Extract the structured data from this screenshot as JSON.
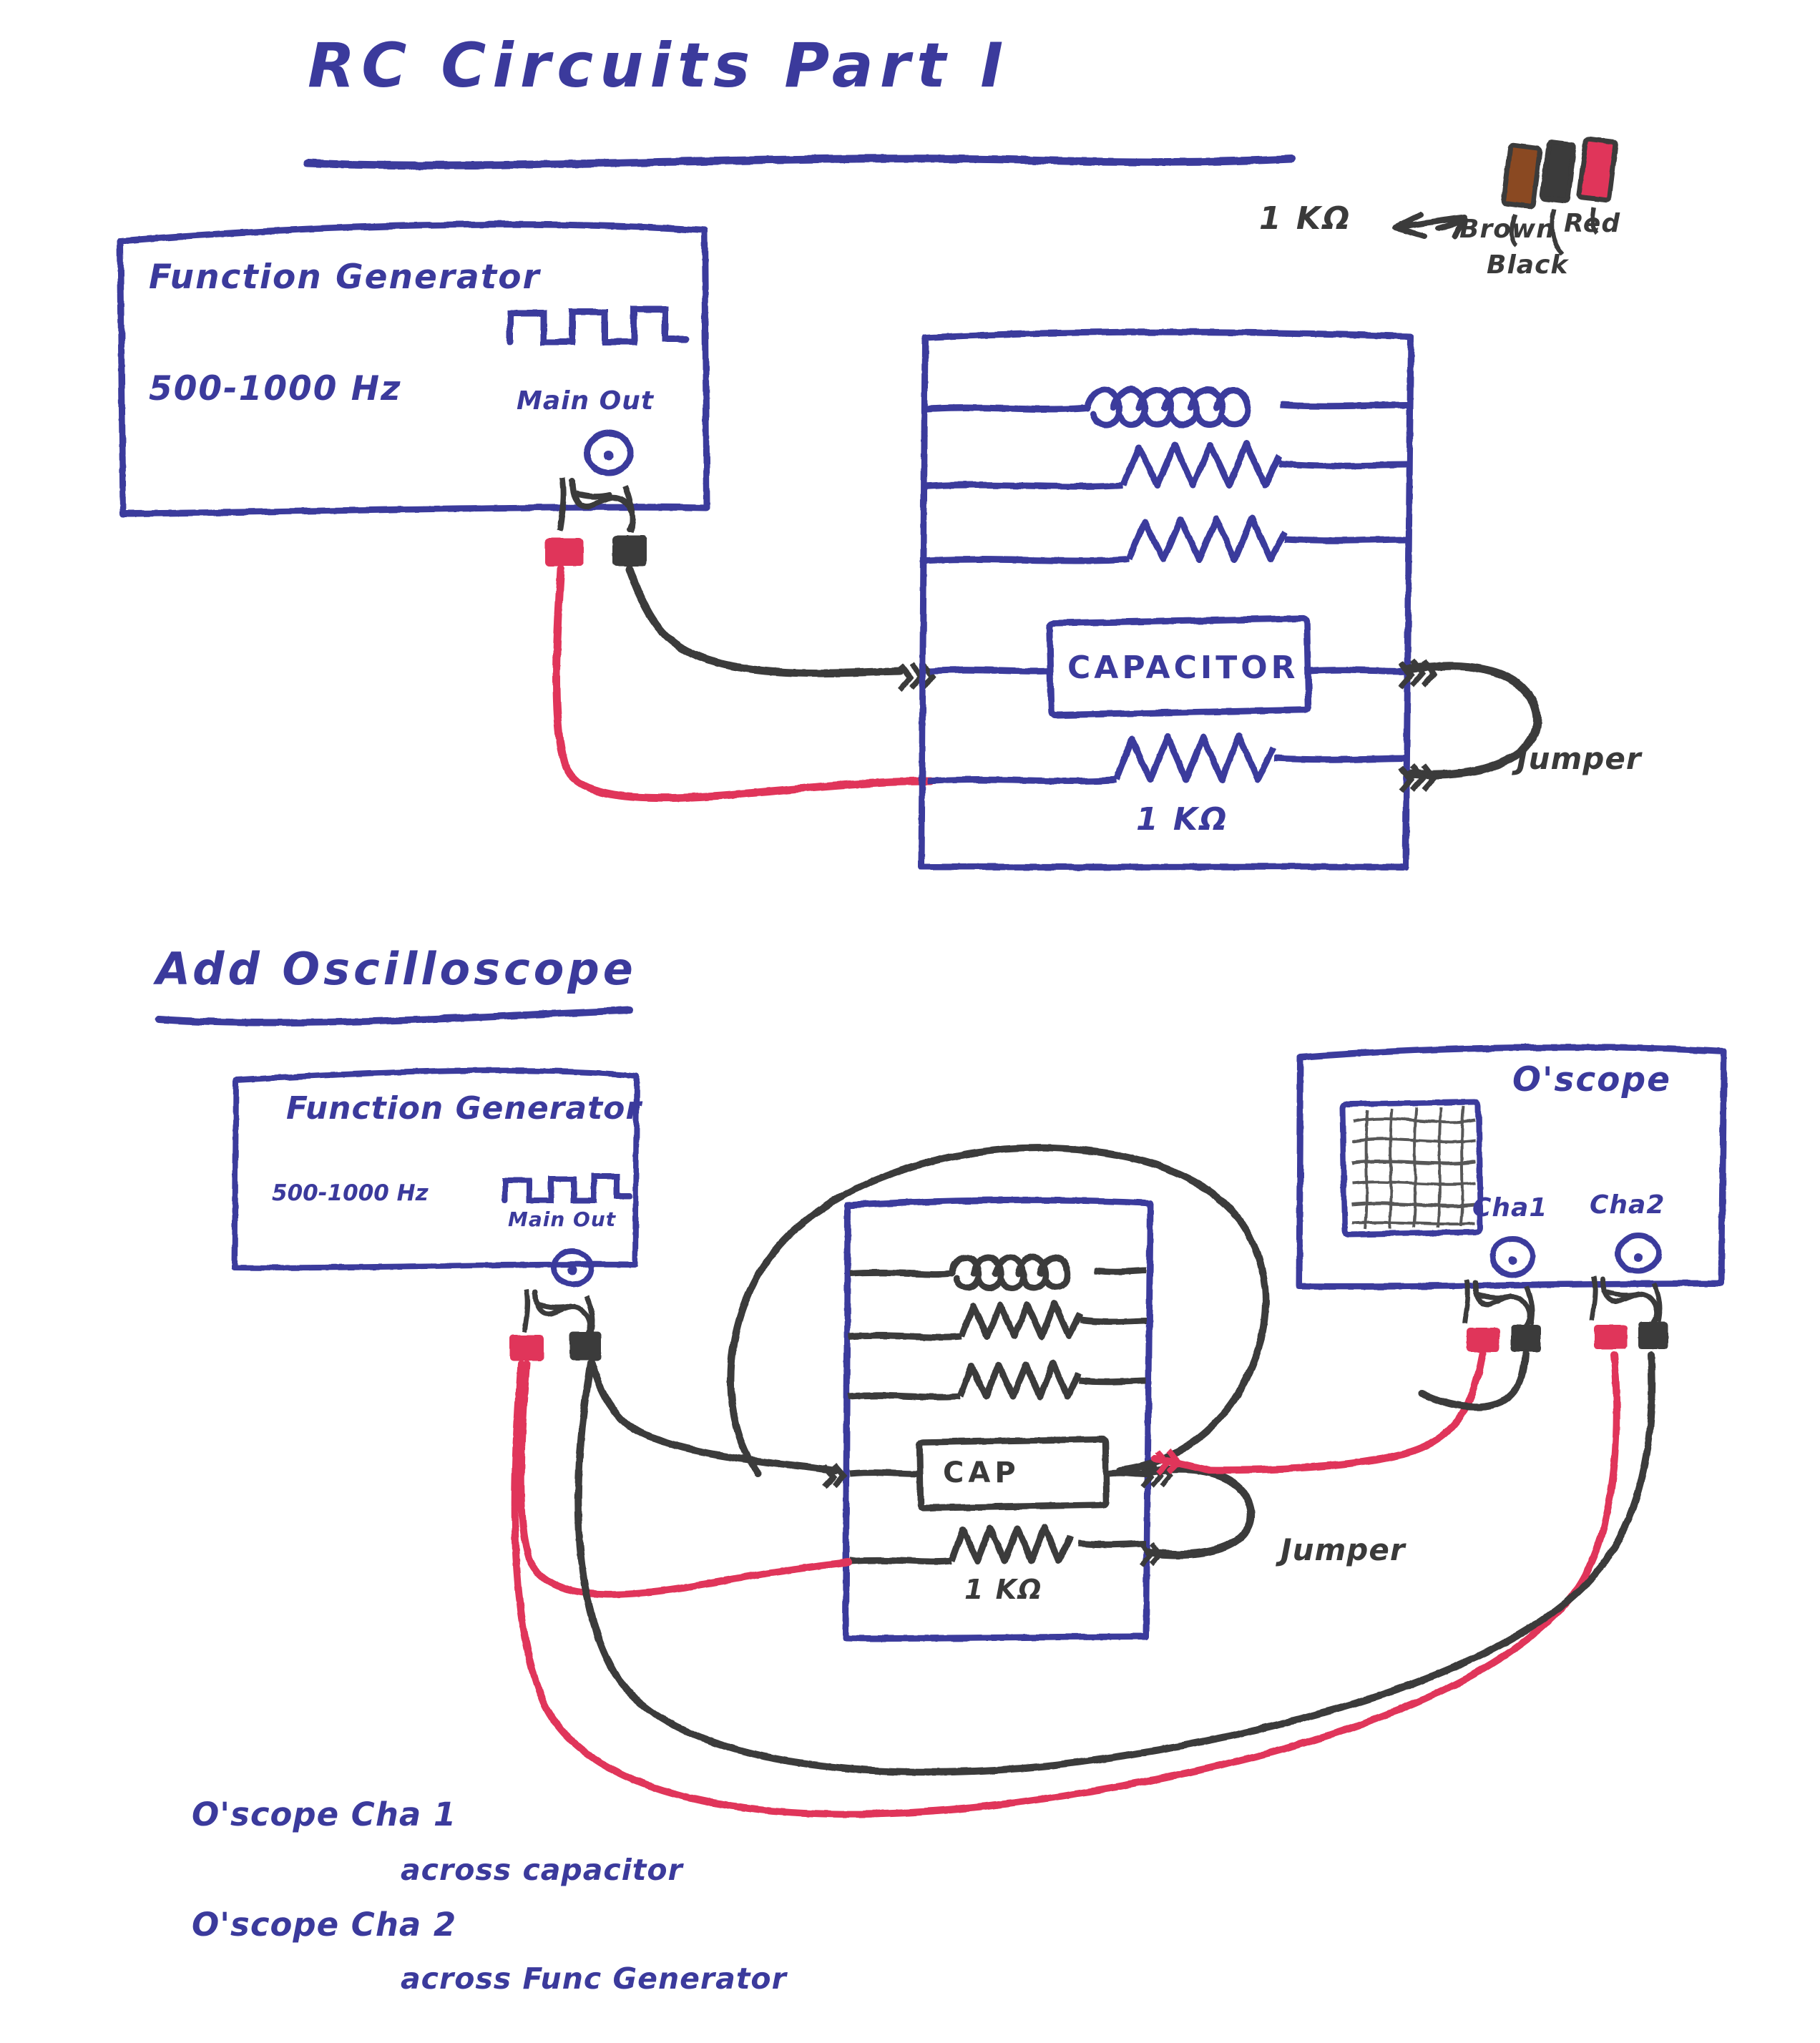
{
  "page": {
    "title": "RC Circuits Part I",
    "ink_blue": "#3b3a9c",
    "ink_black": "#3a3a3a",
    "ink_red": "#e0355a",
    "ink_brown": "#8a4a24",
    "background": "#ffffff"
  },
  "resistor_code": {
    "value_label": "1 KΩ",
    "arrow": "⟹",
    "bands": [
      {
        "name": "Brown",
        "color": "#8a4a24"
      },
      {
        "name": "Black",
        "color": "#3a3a3a"
      },
      {
        "name": "Red",
        "color": "#e0355a"
      }
    ],
    "band_labels": [
      "Brown",
      "Black",
      "Red"
    ]
  },
  "diagram1": {
    "function_generator": {
      "title": "Function Generator",
      "frequency": "500-1000 Hz",
      "output_label": "Main Out",
      "waveform": "square-wave"
    },
    "breadboard": {
      "components": [
        {
          "type": "inductor",
          "label": ""
        },
        {
          "type": "resistor",
          "label": ""
        },
        {
          "type": "resistor",
          "label": ""
        },
        {
          "type": "capacitor-box",
          "label": "CAPACITOR"
        },
        {
          "type": "resistor",
          "label": "1 KΩ"
        }
      ]
    },
    "jumper_label": "Jumper",
    "leads": [
      {
        "color": "#e0355a",
        "name": "red-lead"
      },
      {
        "color": "#3a3a3a",
        "name": "black-lead"
      }
    ]
  },
  "section2": {
    "heading": "Add Oscilloscope",
    "function_generator": {
      "title": "Function Generator",
      "frequency": "500-1000 Hz",
      "output_label": "Main Out",
      "waveform": "square-wave"
    },
    "oscilloscope": {
      "title": "O'scope",
      "channels": [
        "Cha1",
        "Cha2"
      ],
      "screen": "grid-display"
    },
    "breadboard": {
      "components": [
        {
          "type": "inductor",
          "label": ""
        },
        {
          "type": "resistor",
          "label": ""
        },
        {
          "type": "resistor",
          "label": ""
        },
        {
          "type": "capacitor-box",
          "label": "CAP"
        },
        {
          "type": "resistor",
          "label": "1 KΩ"
        }
      ]
    },
    "jumper_label": "Jumper"
  },
  "notes": [
    {
      "line1": "O'scope Cha 1",
      "line2": "across capacitor"
    },
    {
      "line1": "O'scope Cha 2",
      "line2": "across Func Generator"
    }
  ]
}
